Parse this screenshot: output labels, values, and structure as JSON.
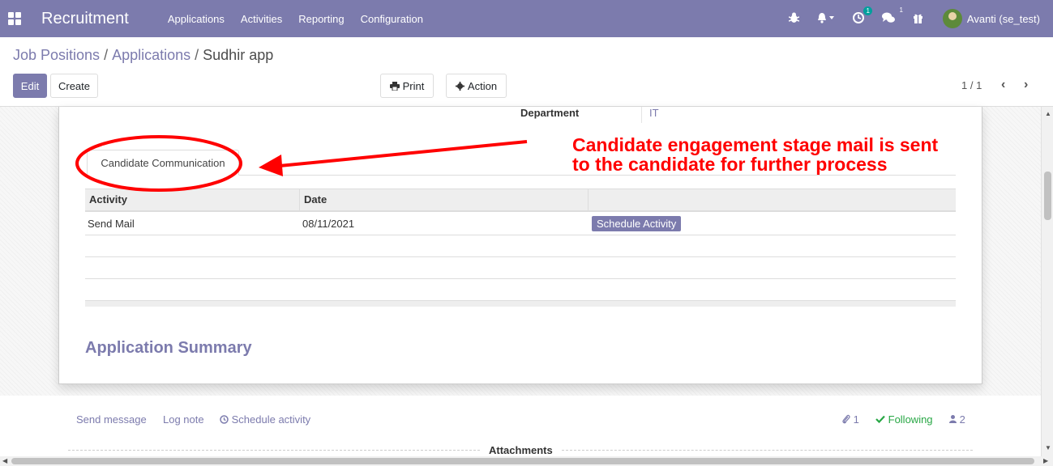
{
  "navbar": {
    "brand": "Recruitment",
    "menu": [
      "Applications",
      "Activities",
      "Reporting",
      "Configuration"
    ],
    "activity_badge": "1",
    "message_badge": "1",
    "user_name": "Avanti (se_test)"
  },
  "breadcrumb": {
    "items": [
      "Job Positions",
      "Applications",
      "Sudhir app"
    ],
    "separator": "/"
  },
  "buttons": {
    "edit": "Edit",
    "create": "Create",
    "print": "Print",
    "action": "Action"
  },
  "pager": {
    "value": "1 / 1"
  },
  "form": {
    "department_label": "Department",
    "department_value": "IT",
    "tab_label": "Candidate Communication",
    "table": {
      "headers": [
        "Activity",
        "Date",
        ""
      ],
      "rows": [
        {
          "activity": "Send Mail",
          "date": "08/11/2021",
          "button": "Schedule Activity"
        }
      ]
    },
    "section_title": "Application Summary"
  },
  "annotation": {
    "line1": "Candidate engagement stage mail is sent",
    "line2": "to the candidate for further process",
    "color": "#ff0000"
  },
  "chatter": {
    "send_message": "Send message",
    "log_note": "Log note",
    "schedule_activity": "Schedule activity",
    "attachments_count": "1",
    "following": "Following",
    "followers_count": "2",
    "attachments_label": "Attachments"
  },
  "colors": {
    "brand": "#7c7bad",
    "following": "#28a745"
  }
}
